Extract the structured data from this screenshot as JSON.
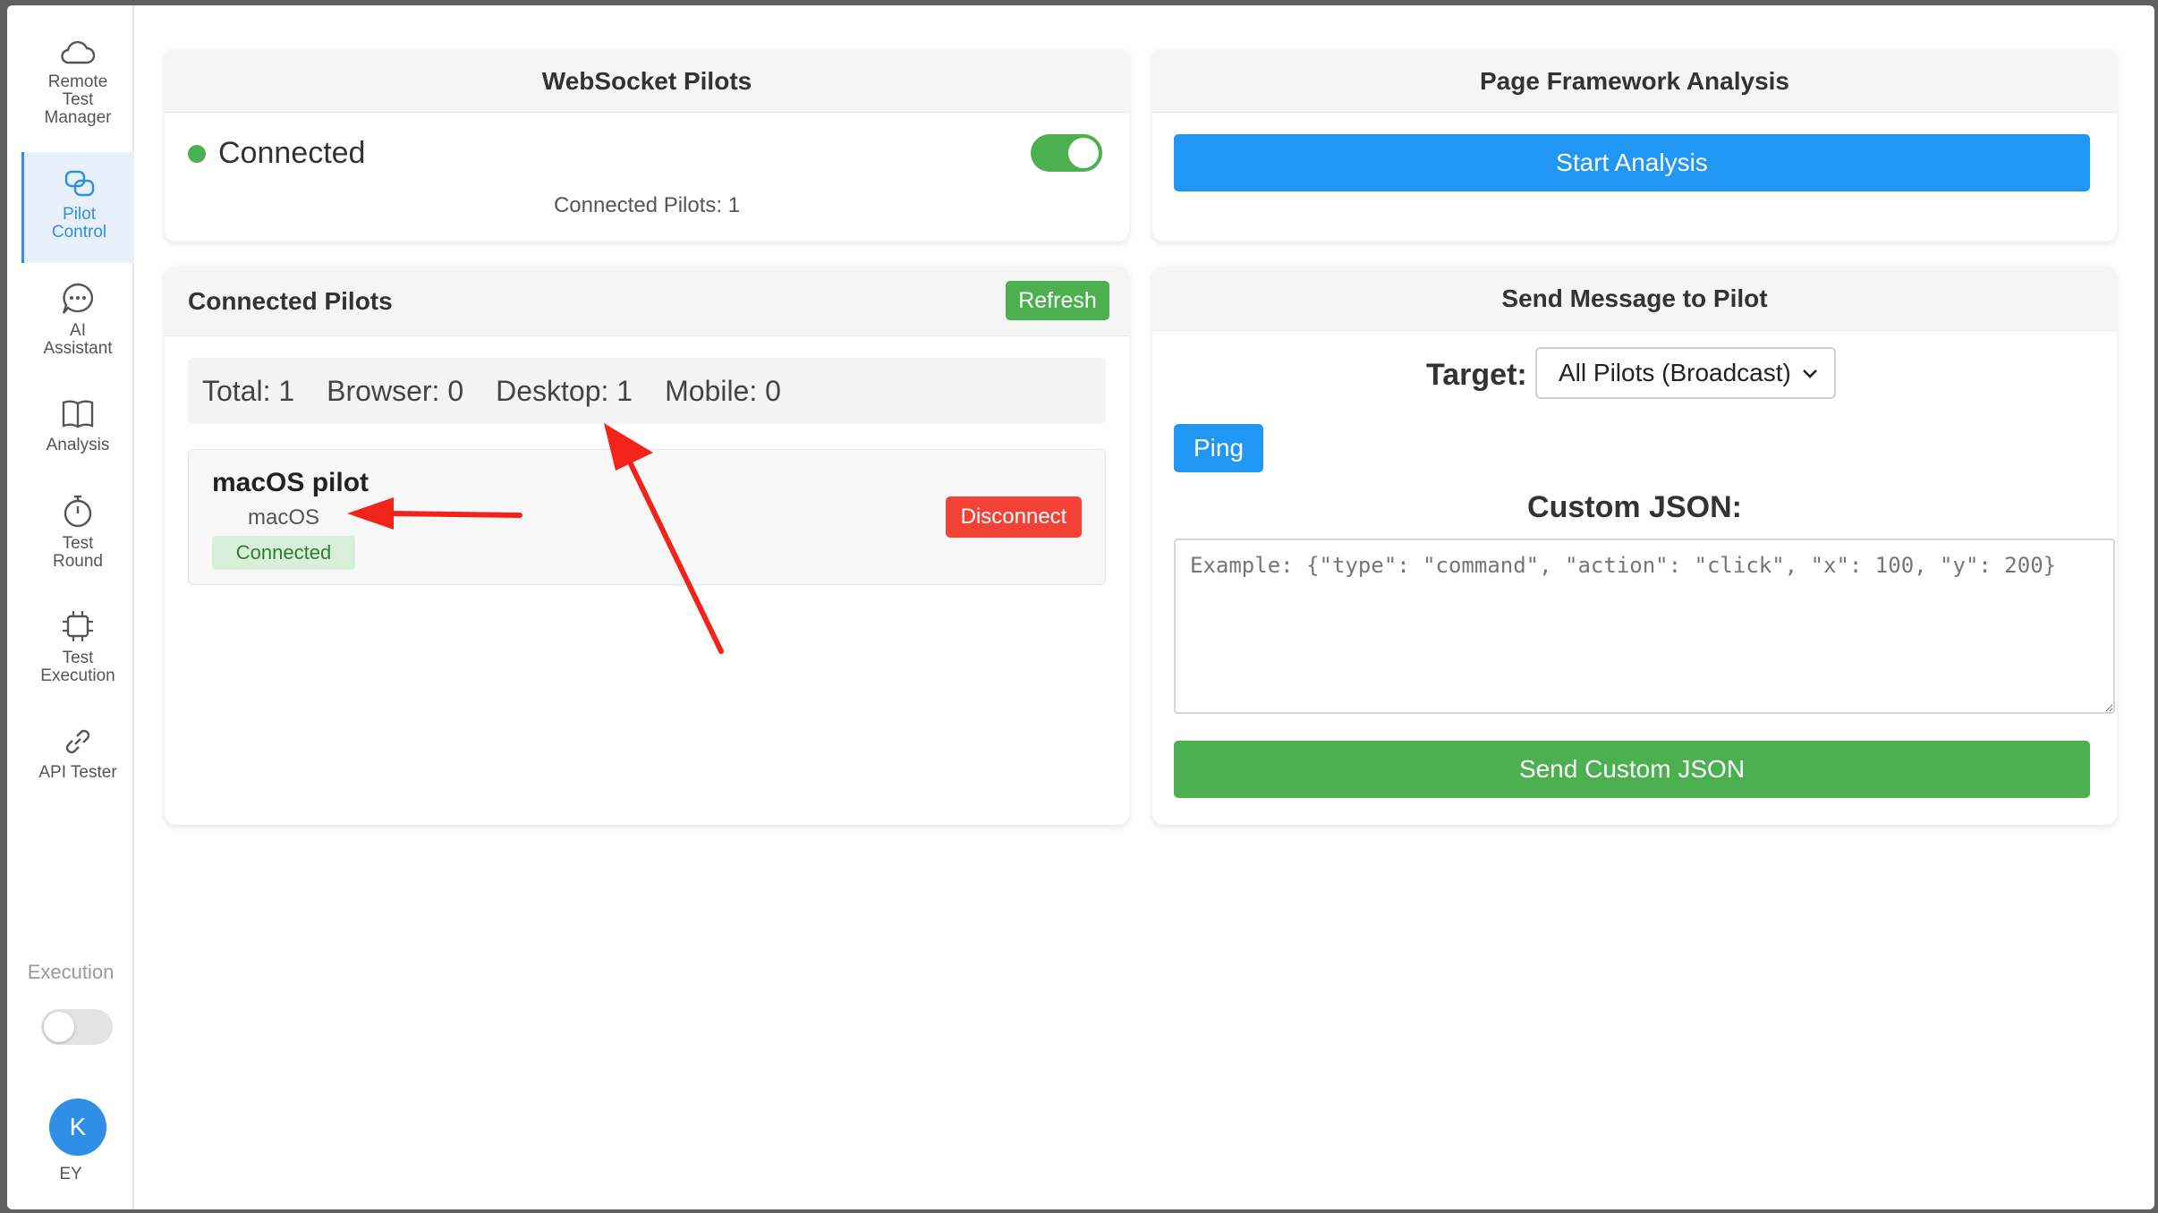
{
  "sidebar": {
    "items": [
      {
        "label": "Remote\nTest\nManager",
        "icon": "cloud-icon"
      },
      {
        "label": "Pilot\nControl",
        "icon": "pilot-link-icon",
        "active": true
      },
      {
        "label": "AI\nAssistant",
        "icon": "chat-bubble-icon"
      },
      {
        "label": "Analysis",
        "icon": "book-icon"
      },
      {
        "label": "Test\nRound",
        "icon": "stopwatch-icon"
      },
      {
        "label": "Test\nExecution",
        "icon": "chip-icon"
      },
      {
        "label": "API Tester",
        "icon": "link-icon"
      }
    ],
    "execution_label": "Execution",
    "avatar_initial": "K",
    "avatar_name": "EY"
  },
  "websocket": {
    "title": "WebSocket Pilots",
    "status": "Connected",
    "connected_count": "Connected Pilots: 1"
  },
  "framework": {
    "title": "Page Framework Analysis",
    "start_button": "Start Analysis"
  },
  "pilots": {
    "title": "Connected Pilots",
    "refresh_button": "Refresh",
    "stats": {
      "total": "Total: 1",
      "browser": "Browser: 0",
      "desktop": "Desktop: 1",
      "mobile": "Mobile: 0"
    },
    "items": [
      {
        "name": "macOS pilot",
        "os": "macOS",
        "status": "Connected",
        "disconnect": "Disconnect"
      }
    ]
  },
  "message": {
    "title": "Send Message to Pilot",
    "target_label": "Target:",
    "target_value": "All Pilots (Broadcast)",
    "ping_button": "Ping",
    "json_title": "Custom JSON:",
    "json_placeholder": "Example: {\"type\": \"command\", \"action\": \"click\", \"x\": 100, \"y\": 200}",
    "send_button": "Send Custom JSON"
  },
  "colors": {
    "accent_blue": "#2196f3",
    "success_green": "#4caf50",
    "danger_red": "#f44336",
    "annotation_red": "#f2231b"
  }
}
